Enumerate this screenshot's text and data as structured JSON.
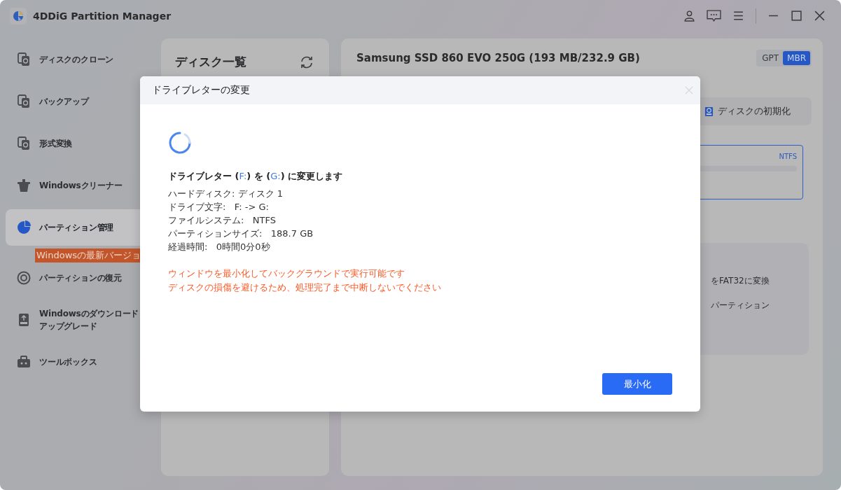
{
  "window": {
    "title": "4DDiG Partition Manager"
  },
  "sidebar": {
    "items": [
      {
        "label": "ディスクのクローン",
        "selected": false
      },
      {
        "label": "バックアップ",
        "selected": false
      },
      {
        "label": "形式変換",
        "selected": false
      },
      {
        "label": "Windowsクリーナー",
        "selected": false
      },
      {
        "label": "パーティション管理",
        "selected": true
      },
      {
        "label": "パーティションの復元",
        "selected": false,
        "badge": "Windowsの最新バージョ"
      },
      {
        "label": "Windowsのダウンロード",
        "label_2": "アップグレード",
        "selected": false
      },
      {
        "label": "ツールボックス",
        "selected": false
      }
    ]
  },
  "disk_list": {
    "title": "ディスク一覧"
  },
  "disk": {
    "title": "Samsung SSD 860 EVO 250G (193 MB/232.9 GB)",
    "styles": [
      {
        "label": "GPT",
        "selected": false
      },
      {
        "label": "MBR",
        "selected": true
      }
    ],
    "tab": "ディスクの初期化",
    "partition": {
      "file_system": "NTFS"
    },
    "tools": [
      "をFAT32に変換",
      "パーティション"
    ]
  },
  "dialog": {
    "title": "ドライブレターの変更",
    "heading": [
      {
        "text": "ドライブレター ("
      },
      {
        "text": "F:",
        "kind": "drive"
      },
      {
        "text": ") を ("
      },
      {
        "text": "G:",
        "kind": "drive"
      },
      {
        "text": ") に変更します"
      }
    ],
    "details": [
      "ハードディスク: ディスク 1",
      "ドライブ文字:   F: -> G:",
      "ファイルシステム:   NTFS",
      "パーティションサイズ:   188.7 GB",
      "経過時間:   0時間0分0秒"
    ],
    "warnings": [
      "ウィンドウを最小化してバックグラウンドで実行可能です",
      "ディスクの損傷を避けるため、処理完了まで中断しないでください"
    ],
    "button": "最小化"
  }
}
